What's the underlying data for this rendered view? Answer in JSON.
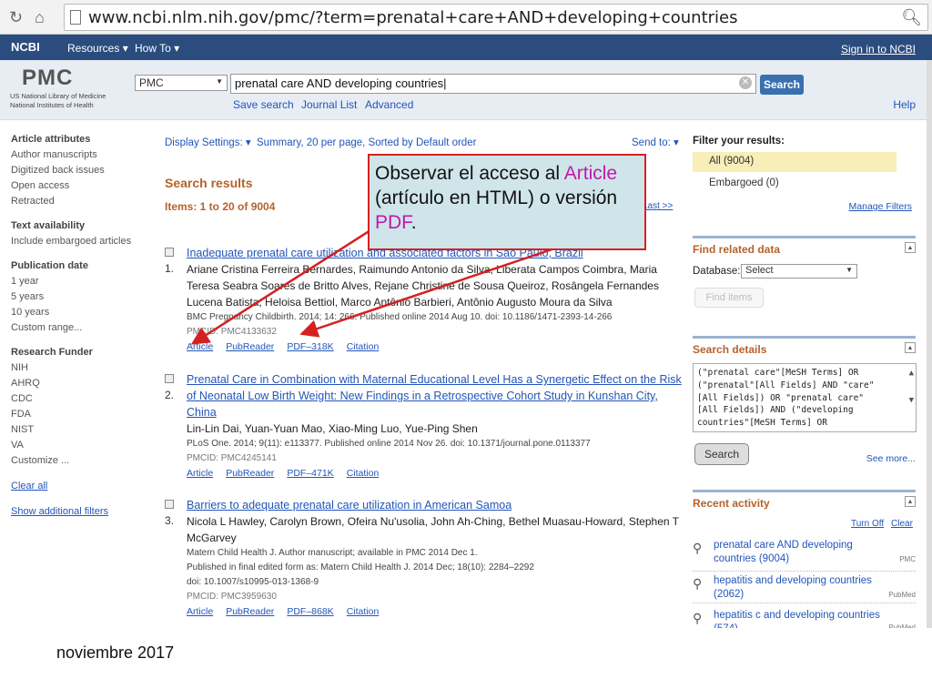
{
  "browser": {
    "url": "www.ncbi.nlm.nih.gov/pmc/?term=prenatal+care+AND+developing+countries"
  },
  "ncbi_bar": {
    "logo": "NCBI",
    "resources": "Resources",
    "howto": "How To",
    "signin": "Sign in to NCBI"
  },
  "header": {
    "logo": "PMC",
    "sub1": "US National Library of Medicine",
    "sub2": "National Institutes of Health",
    "db": "PMC",
    "query": "prenatal care AND developing countries",
    "search": "Search",
    "save_search": "Save search",
    "journal_list": "Journal List",
    "advanced": "Advanced",
    "help": "Help"
  },
  "sidebar": {
    "article_attributes": "Article attributes",
    "author_manuscripts": "Author manuscripts",
    "digitized": "Digitized back issues",
    "open_access": "Open access",
    "retracted": "Retracted",
    "text_availability": "Text availability",
    "include_embargoed": "Include embargoed articles",
    "publication_date": "Publication date",
    "year1": "1 year",
    "year5": "5 years",
    "year10": "10 years",
    "custom_range": "Custom range...",
    "research_funder": "Research Funder",
    "f1": "NIH",
    "f2": "AHRQ",
    "f3": "CDC",
    "f4": "FDA",
    "f5": "NIST",
    "f6": "VA",
    "customize": "Customize ...",
    "clear_all": "Clear all",
    "show_filters": "Show additional filters"
  },
  "main": {
    "display_settings": "Display Settings:",
    "display_value": "Summary, 20 per page, Sorted by Default order",
    "send_to": "Send to:",
    "search_results": "Search results",
    "items": "Items: 1 to 20 of 9004",
    "last": "Last >>",
    "results": [
      {
        "num": "1.",
        "title": "Inadequate prenatal care utilization and associated factors in São Paulo, Brazil",
        "authors": "Ariane Cristina Ferreira Bernardes, Raimundo Antonio da Silva, Liberata Campos Coimbra, Maria Teresa Seabra Soares de Britto Alves, Rejane Christine de Sousa Queiroz, Rosângela Fernandes Lucena Batista, Heloisa Bettiol, Marco Antônio Barbieri, Antônio Augusto Moura da Silva",
        "cite": "BMC Pregnancy Childbirth. 2014; 14: 266. Published online 2014 Aug 10. doi: 10.1186/1471-2393-14-266",
        "pmcid": "PMCID: PMC4133632",
        "l1": "Article",
        "l2": "PubReader",
        "l3": "PDF–318K",
        "l4": "Citation"
      },
      {
        "num": "2.",
        "title": "Prenatal Care in Combination with Maternal Educational Level Has a Synergetic Effect on the Risk of Neonatal Low Birth Weight: New Findings in a Retrospective Cohort Study in Kunshan City, China",
        "authors": "Lin-Lin Dai, Yuan-Yuan Mao, Xiao-Ming Luo, Yue-Ping Shen",
        "cite": "PLoS One. 2014; 9(11): e113377. Published online 2014 Nov 26. doi: 10.1371/journal.pone.0113377",
        "pmcid": "PMCID: PMC4245141",
        "l1": "Article",
        "l2": "PubReader",
        "l3": "PDF–471K",
        "l4": "Citation"
      },
      {
        "num": "3.",
        "title": "Barriers to adequate prenatal care utilization in American Samoa",
        "authors": "Nicola L Hawley, Carolyn Brown, Ofeira Nu'usolia, John Ah-Ching, Bethel Muasau-Howard, Stephen T McGarvey",
        "cite": "Matern Child Health J. Author manuscript; available in PMC 2014 Dec 1.",
        "cite2": "Published in final edited form as: Matern Child Health J. 2014 Dec; 18(10): 2284–2292",
        "cite3": "doi: 10.1007/s10995-013-1368-9",
        "pmcid": "PMCID: PMC3959630",
        "l1": "Article",
        "l2": "PubReader",
        "l3": "PDF–868K",
        "l4": "Citation"
      }
    ]
  },
  "right": {
    "filter_header": "Filter your results:",
    "all": "All (9004)",
    "embargoed": "Embargoed (0)",
    "manage": "Manage Filters",
    "find_related": "Find related data",
    "database": "Database:",
    "select": "Select",
    "find_items": "Find items",
    "search_details": "Search details",
    "details_text": "(\"prenatal care\"[MeSH Terms] OR\n(\"prenatal\"[All Fields] AND \"care\"\n[All Fields]) OR \"prenatal care\"\n[All Fields]) AND (\"developing\ncountries\"[MeSH Terms] OR",
    "search": "Search",
    "see_more": "See more...",
    "recent_activity": "Recent activity",
    "turn_off": "Turn Off",
    "clear": "Clear",
    "activity": [
      {
        "text": "prenatal care AND developing countries (9004)",
        "src": "PMC"
      },
      {
        "text": "hepatitis and developing countries (2062)",
        "src": "PubMed"
      },
      {
        "text": "hepatitis c and developing countries (574)",
        "src": "PubMed"
      }
    ]
  },
  "callout": {
    "t1": "Observar el acceso al ",
    "t2": "Article",
    "t3": " (artículo en HTML) o versión ",
    "t4": "PDF",
    "t5": "."
  },
  "footer": "noviembre 2017"
}
